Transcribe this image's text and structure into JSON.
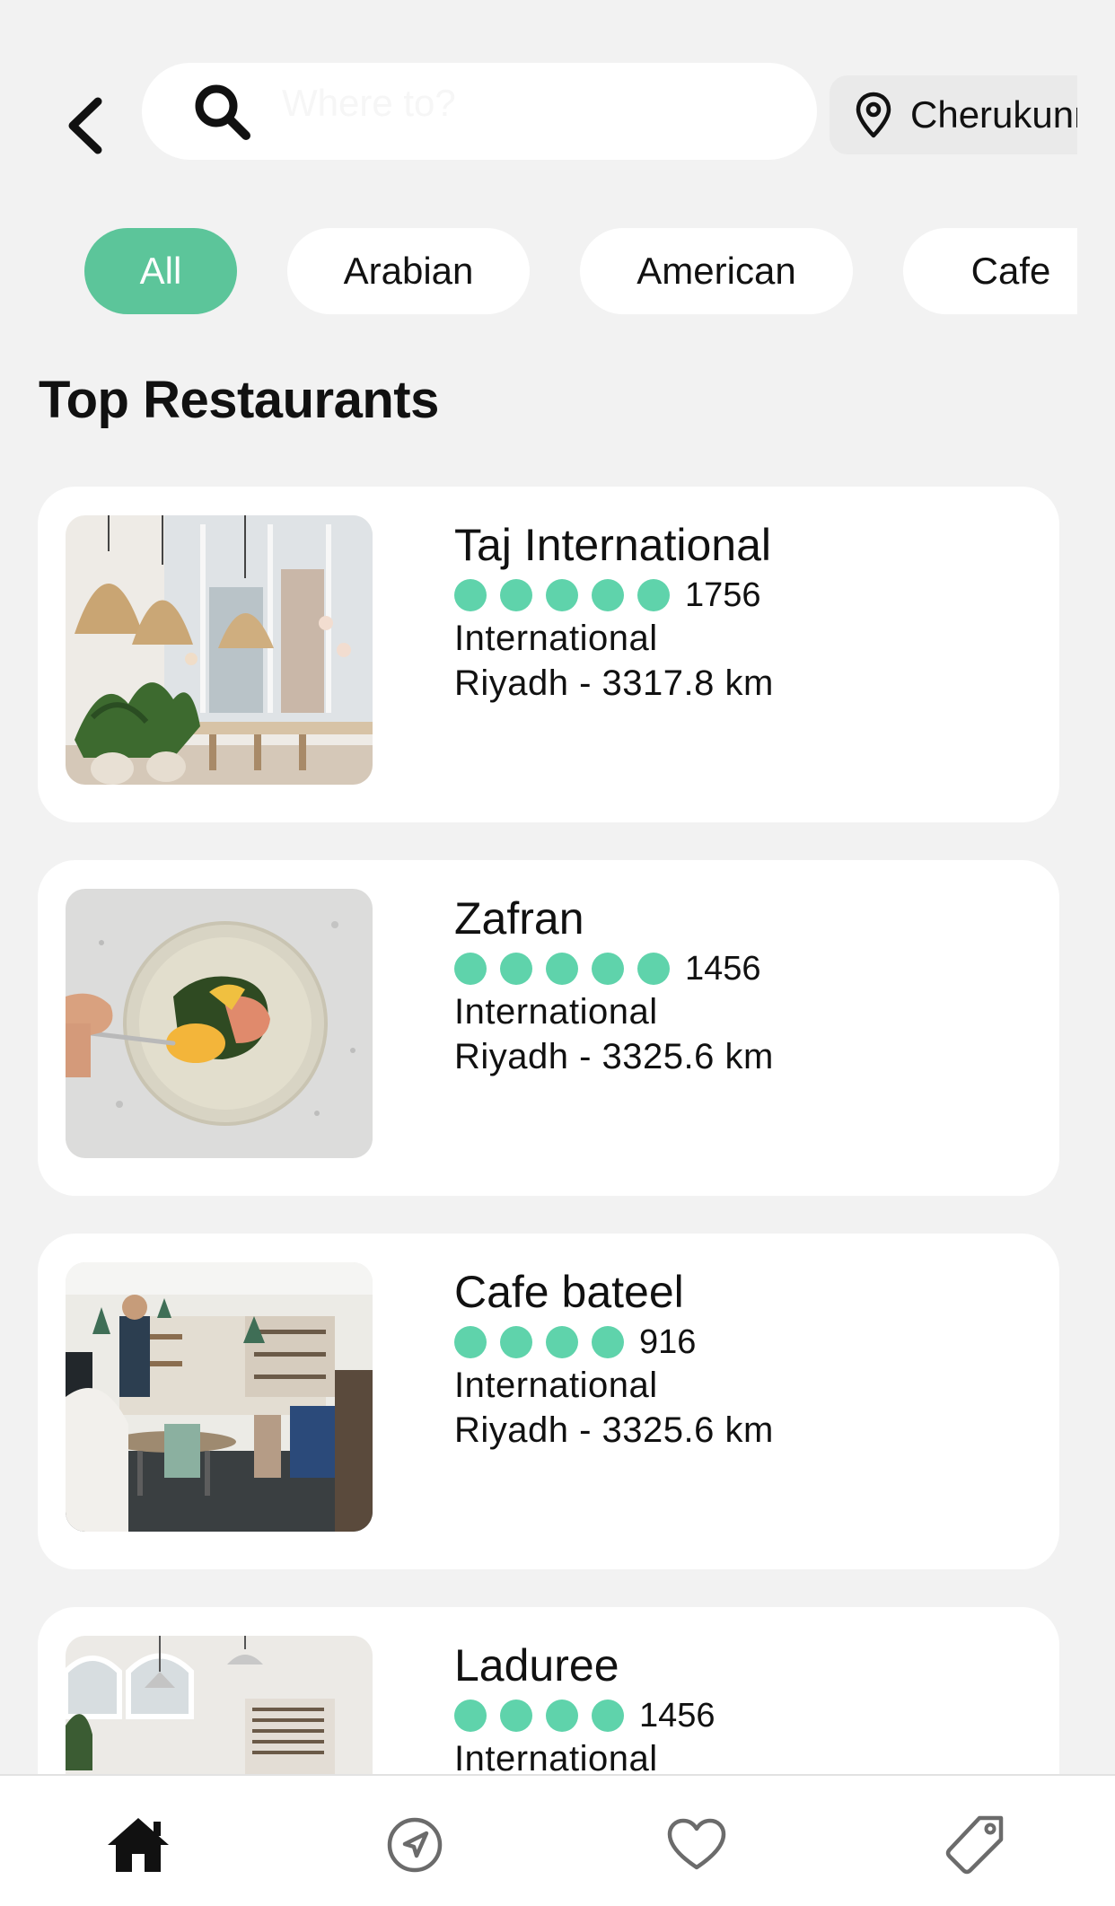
{
  "header": {
    "search_placeholder": "Where to?",
    "location_label": "Cherukunnu"
  },
  "categories": [
    {
      "label": "All",
      "active": true
    },
    {
      "label": "Arabian",
      "active": false
    },
    {
      "label": "American",
      "active": false
    },
    {
      "label": "Cafe",
      "active": false
    }
  ],
  "section_title": "Top Restaurants",
  "restaurants": [
    {
      "name": "Taj International",
      "rating_dots": 5,
      "rating_count": "1756",
      "cuisine": "International",
      "location": "Riyadh - 3317.8 km"
    },
    {
      "name": "Zafran",
      "rating_dots": 5,
      "rating_count": "1456",
      "cuisine": "International",
      "location": "Riyadh - 3325.6 km"
    },
    {
      "name": "Cafe bateel",
      "rating_dots": 4,
      "rating_count": "916",
      "cuisine": "International",
      "location": "Riyadh - 3325.6 km"
    },
    {
      "name": "Laduree",
      "rating_dots": 4,
      "rating_count": "1456",
      "cuisine": "International",
      "location": ""
    }
  ],
  "nav": [
    {
      "icon": "home-icon",
      "active": true
    },
    {
      "icon": "navigation-icon",
      "active": false
    },
    {
      "icon": "heart-icon",
      "active": false
    },
    {
      "icon": "tag-icon",
      "active": false
    }
  ],
  "colors": {
    "accent": "#5cc59a",
    "rating_dot": "#5fd3ab",
    "background": "#f2f2f2"
  }
}
